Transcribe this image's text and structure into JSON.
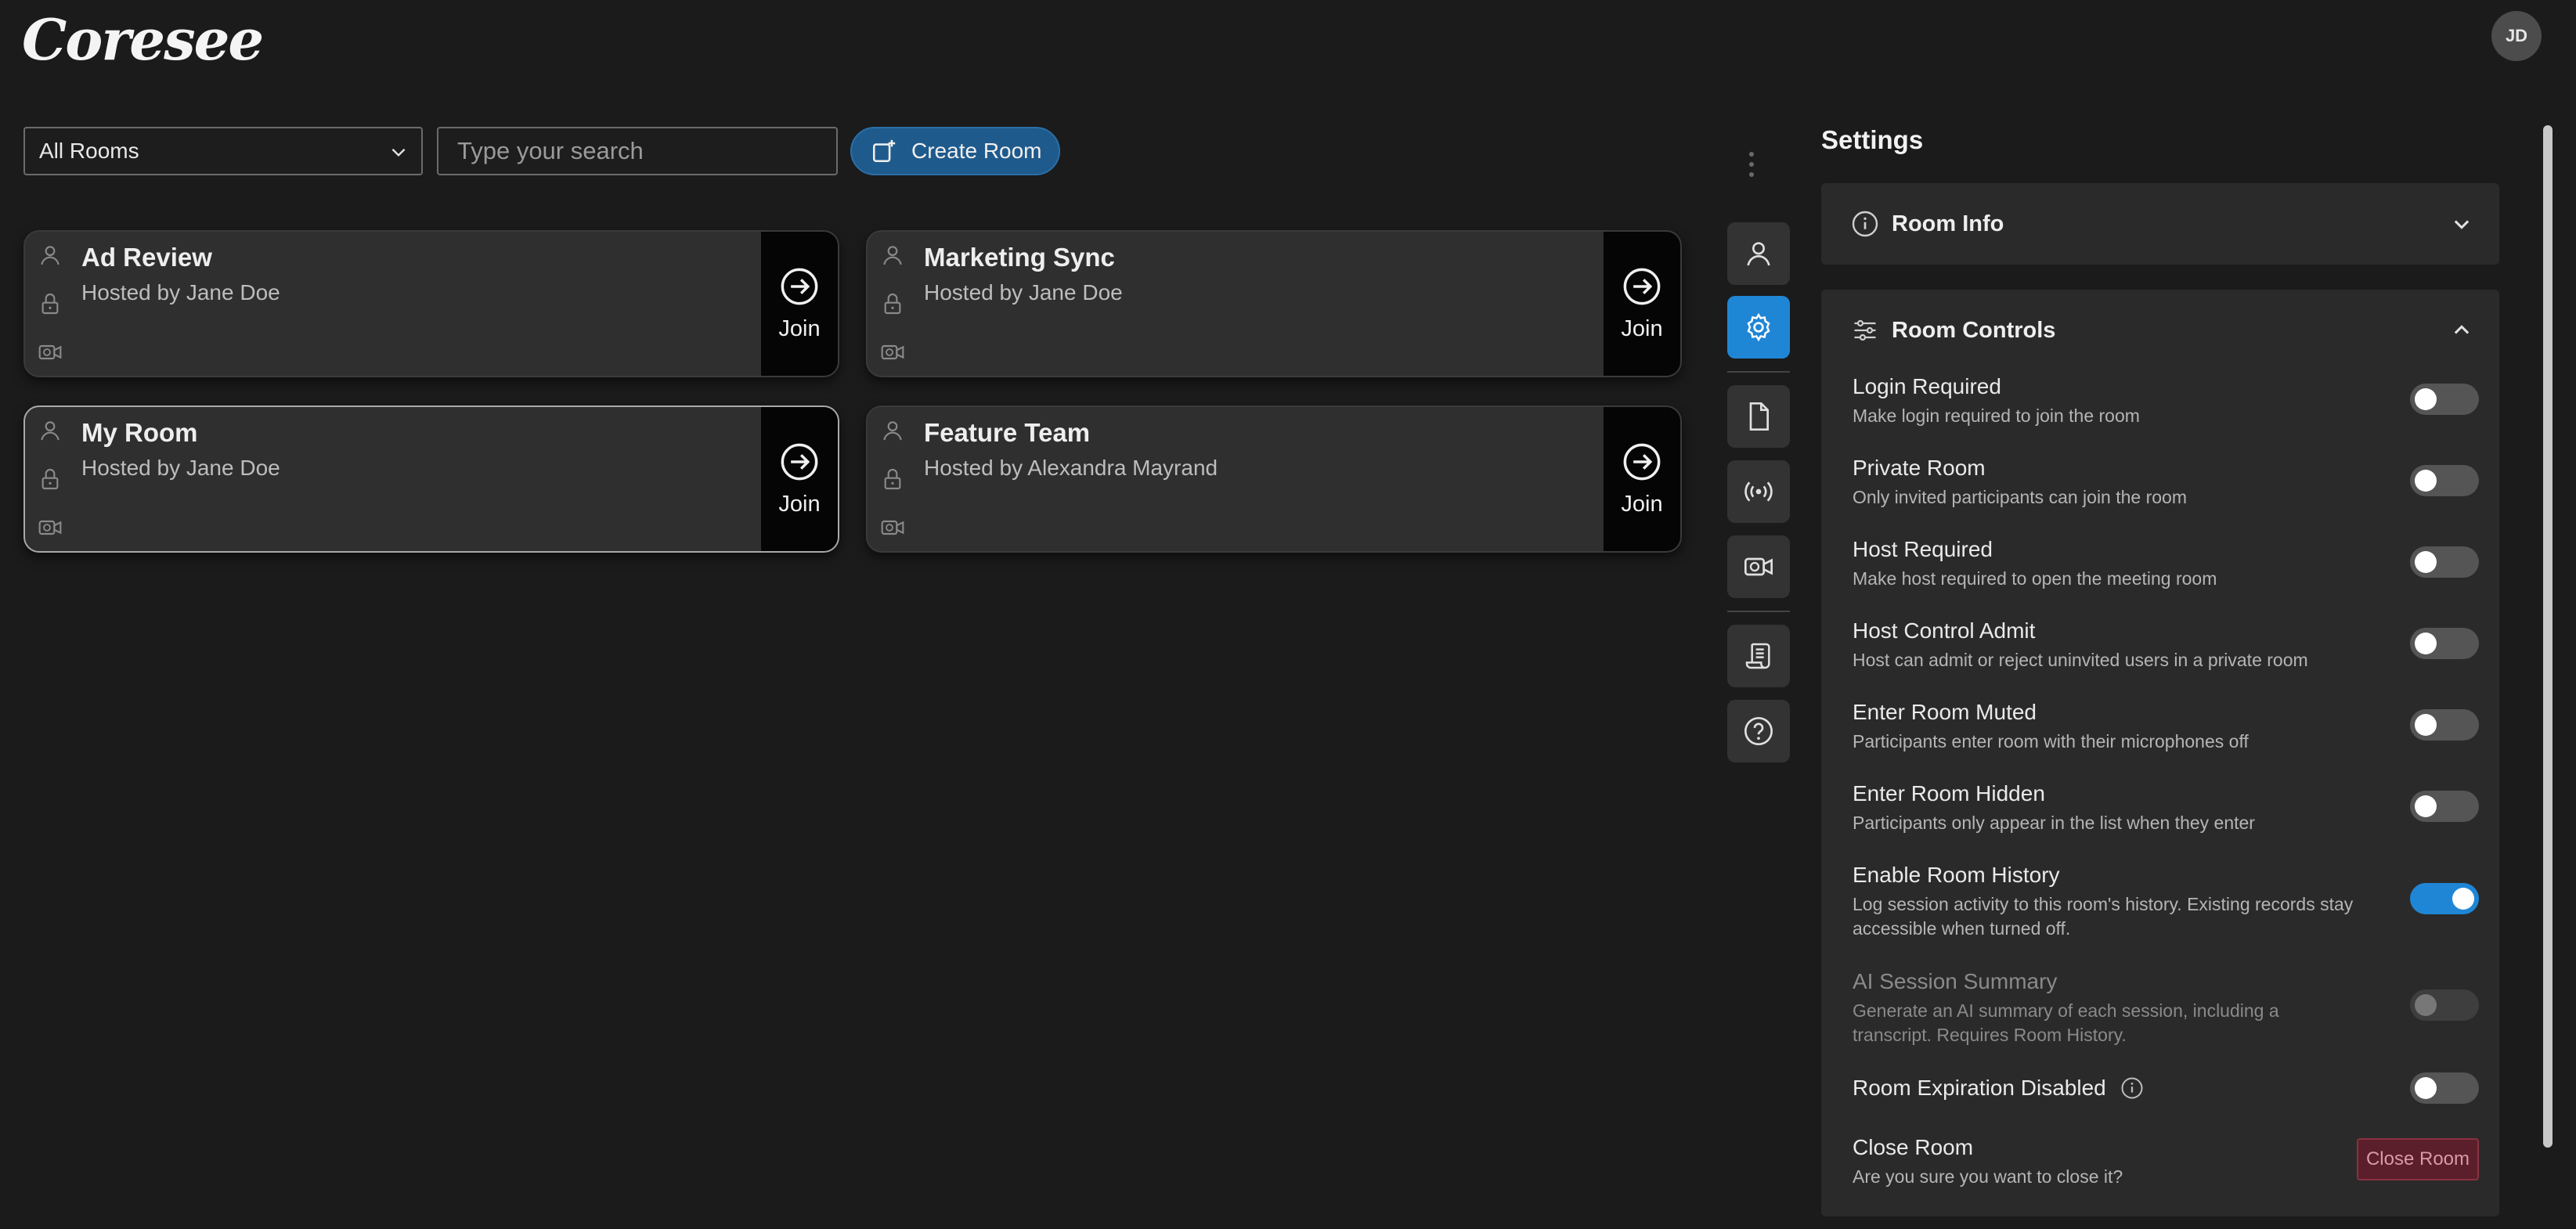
{
  "app": {
    "logo": "Coresee",
    "avatar_initials": "JD"
  },
  "toolbar": {
    "room_filter": "All Rooms",
    "search_placeholder": "Type your search",
    "create_room_label": "Create Room"
  },
  "rooms": [
    {
      "name": "Ad Review",
      "host": "Hosted by Jane Doe",
      "join_label": "Join"
    },
    {
      "name": "Marketing Sync",
      "host": "Hosted by Jane Doe",
      "join_label": "Join"
    },
    {
      "name": "My Room",
      "host": "Hosted by Jane Doe",
      "join_label": "Join"
    },
    {
      "name": "Feature Team",
      "host": "Hosted by Alexandra Mayrand",
      "join_label": "Join"
    }
  ],
  "settings": {
    "title": "Settings",
    "room_info_label": "Room Info",
    "room_controls_label": "Room Controls",
    "controls": [
      {
        "label": "Login Required",
        "desc": "Make login required to join the room",
        "enabled": false
      },
      {
        "label": "Private Room",
        "desc": "Only invited participants can join the room",
        "enabled": false
      },
      {
        "label": "Host Required",
        "desc": "Make host required to open the meeting room",
        "enabled": false
      },
      {
        "label": "Host Control Admit",
        "desc": "Host can admit or reject uninvited users in a private room",
        "enabled": false
      },
      {
        "label": "Enter Room Muted",
        "desc": "Participants enter room with their microphones off",
        "enabled": false
      },
      {
        "label": "Enter Room Hidden",
        "desc": "Participants only appear in the list when they enter",
        "enabled": false
      },
      {
        "label": "Enable Room History",
        "desc": "Log session activity to this room's history. Existing records stay accessible when turned off.",
        "enabled": true
      },
      {
        "label": "AI Session Summary",
        "desc": "Generate an AI summary of each session, including a transcript. Requires Room History.",
        "enabled": false
      },
      {
        "label": "Room Expiration Disabled",
        "desc": "",
        "enabled": false
      }
    ],
    "close_room": {
      "label": "Close Room",
      "desc": "Are you sure you want to close it?",
      "button_label": "Close Room"
    }
  },
  "colors": {
    "accent": "#1f86d6",
    "background": "#1b1b1b",
    "card": "#2f2f2f",
    "danger": "#5a1f2a"
  }
}
